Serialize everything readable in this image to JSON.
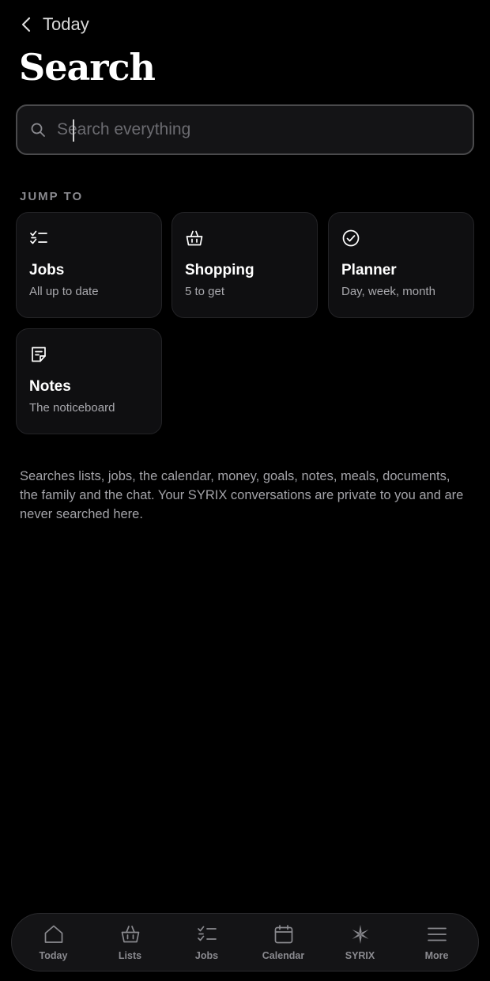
{
  "header": {
    "back_label": "Today",
    "title": "Search"
  },
  "search": {
    "placeholder": "Search everything",
    "value": ""
  },
  "jump_to": {
    "label": "JUMP TO",
    "cards": [
      {
        "title": "Jobs",
        "subtitle": "All up to date",
        "icon": "checklist-icon"
      },
      {
        "title": "Shopping",
        "subtitle": "5 to get",
        "icon": "basket-icon"
      },
      {
        "title": "Planner",
        "subtitle": "Day, week, month",
        "icon": "check-circle-icon"
      },
      {
        "title": "Notes",
        "subtitle": "The noticeboard",
        "icon": "note-icon"
      }
    ]
  },
  "description": "Searches lists, jobs, the calendar, money, goals, notes, meals, documents, the family and the chat. Your SYRIX conversations are private to you and are never searched here.",
  "bottom_nav": {
    "items": [
      {
        "label": "Today",
        "icon": "home-icon"
      },
      {
        "label": "Lists",
        "icon": "basket-icon"
      },
      {
        "label": "Jobs",
        "icon": "checklist-icon"
      },
      {
        "label": "Calendar",
        "icon": "calendar-icon"
      },
      {
        "label": "SYRIX",
        "icon": "syrix-star-icon"
      },
      {
        "label": "More",
        "icon": "menu-icon"
      }
    ]
  }
}
